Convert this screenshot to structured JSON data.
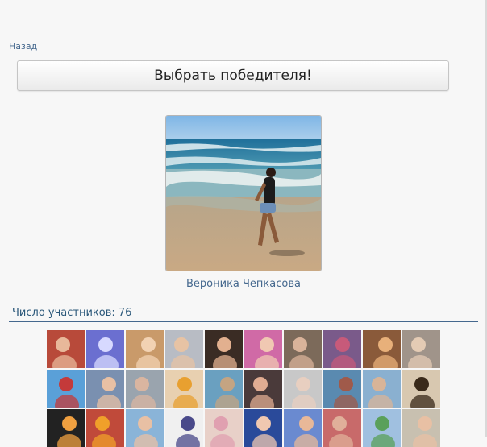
{
  "nav": {
    "back_label": "Назад"
  },
  "actions": {
    "pick_winner_label": "Выбрать победителя!"
  },
  "winner": {
    "name": "Вероника Чепкасова"
  },
  "participants": {
    "count_label": "Число участников: 76",
    "thumbnails": [
      {
        "bg": "#b84a3a",
        "figure": "#e8b89a"
      },
      {
        "bg": "#6b6fd0",
        "figure": "#d7d9ff"
      },
      {
        "bg": "#c99a6a",
        "figure": "#f2d2b3"
      },
      {
        "bg": "#b8bcc4",
        "figure": "#e7c3a4"
      },
      {
        "bg": "#3a2c24",
        "figure": "#e2b08f"
      },
      {
        "bg": "#d06aa6",
        "figure": "#f0c8b2"
      },
      {
        "bg": "#7c6a5a",
        "figure": "#d9b39a"
      },
      {
        "bg": "#7a5a8a",
        "figure": "#c75a7a"
      },
      {
        "bg": "#8a5a3a",
        "figure": "#e8b07a"
      },
      {
        "bg": "#a0948a",
        "figure": "#e4cbb4"
      },
      {
        "bg": "#5aa0d8",
        "figure": "#c43a3a"
      },
      {
        "bg": "#7a90b0",
        "figure": "#e8c0a4"
      },
      {
        "bg": "#9aa4ae",
        "figure": "#d9b5a0"
      },
      {
        "bg": "#e8d0b0",
        "figure": "#e8a030"
      },
      {
        "bg": "#6aa0c0",
        "figure": "#c4a482"
      },
      {
        "bg": "#4a3a3a",
        "figure": "#e0ac92"
      },
      {
        "bg": "#c8c8c8",
        "figure": "#e8cfc0"
      },
      {
        "bg": "#5a8ab0",
        "figure": "#a05a4a"
      },
      {
        "bg": "#8ab0d0",
        "figure": "#d8b498"
      },
      {
        "bg": "#d8c8b0",
        "figure": "#3a2a1a"
      },
      {
        "bg": "#222222",
        "figure": "#f0a040"
      },
      {
        "bg": "#c04a3a",
        "figure": "#f0a02a"
      },
      {
        "bg": "#8ab4d8",
        "figure": "#e8c0a4"
      },
      {
        "bg": "#f0f0f0",
        "figure": "#4a4a8a"
      },
      {
        "bg": "#e8d0c8",
        "figure": "#e0a0b0"
      },
      {
        "bg": "#2a4a9a",
        "figure": "#f0c8b0"
      },
      {
        "bg": "#6a8ad0",
        "figure": "#e8b898"
      },
      {
        "bg": "#c86a6a",
        "figure": "#e0b09a"
      },
      {
        "bg": "#a0c0e0",
        "figure": "#5aa05a"
      },
      {
        "bg": "#c8c0b0",
        "figure": "#e8c0a4"
      }
    ]
  },
  "colors": {
    "link": "#45688e",
    "divider": "#45688e",
    "background": "#f7f7f7"
  }
}
